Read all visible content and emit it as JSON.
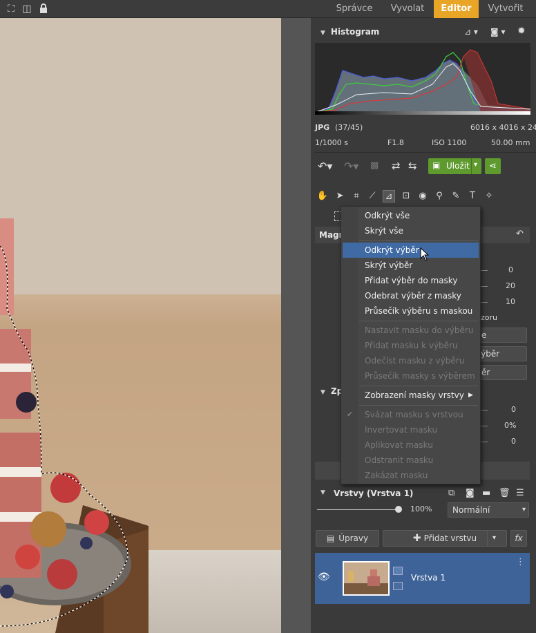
{
  "topbar": {
    "icons": [
      "fullscreen-icon",
      "compare-icon",
      "lock-icon"
    ],
    "modules": [
      {
        "label": "Správce",
        "active": false
      },
      {
        "label": "Vyvolat",
        "active": false
      },
      {
        "label": "Editor",
        "active": true
      },
      {
        "label": "Vytvořit",
        "active": false
      }
    ]
  },
  "histogram": {
    "title": "Histogram",
    "format": "JPG",
    "index": "(37/45)",
    "dimensions": "6016 x 4016 x 24",
    "shutter": "1/1000 s",
    "aperture": "F1.8",
    "iso": "ISO 1100",
    "focal": "50.00 mm"
  },
  "actions": {
    "save_label": "Uložit"
  },
  "sections": {
    "magic_title": "Magr",
    "zp_title": "Zp",
    "layers_title": "Vrstvy (Vrstva 1)"
  },
  "sliders": {
    "v1": "0",
    "v2": "20",
    "v3": "10",
    "row_text": "zoru",
    "btn1": "e",
    "btn2": "výběr",
    "btn3": "ěr",
    "z1": "0",
    "z2": "0%",
    "z3": "0"
  },
  "layers": {
    "opacity": "100%",
    "blend_mode": "Normální",
    "adjust_label": "Úpravy",
    "add_layer_label": "Přidat vrstvu",
    "fx_label": "fx",
    "layer_name": "Vrstva 1"
  },
  "menu": {
    "items": [
      {
        "label": "Odkrýt vše",
        "enabled": true
      },
      {
        "label": "Skrýt vše",
        "enabled": true
      },
      {
        "label": "Odkrýt výběr",
        "enabled": true,
        "highlighted": true
      },
      {
        "label": "Skrýt výběr",
        "enabled": true
      },
      {
        "label": "Přidat výběr do masky",
        "enabled": true
      },
      {
        "label": "Odebrat výběr z masky",
        "enabled": true
      },
      {
        "label": "Průsečík výběru s maskou",
        "enabled": true
      },
      {
        "label": "Nastavit masku do výběru",
        "enabled": false
      },
      {
        "label": "Přidat masku k výběru",
        "enabled": false
      },
      {
        "label": "Odečíst masku z výběru",
        "enabled": false
      },
      {
        "label": "Průsečík masky s výběrem",
        "enabled": false
      },
      {
        "label": "Zobrazení masky vrstvy",
        "enabled": true,
        "submenu": true
      },
      {
        "label": "Svázat masku s vrstvou",
        "enabled": false,
        "checked": true
      },
      {
        "label": "Invertovat masku",
        "enabled": false
      },
      {
        "label": "Aplikovat masku",
        "enabled": false
      },
      {
        "label": "Odstranit masku",
        "enabled": false
      },
      {
        "label": "Zakázat masku",
        "enabled": false
      }
    ]
  },
  "colors": {
    "accent": "#e8a526",
    "selection_blue": "#3e6398",
    "save_green": "#5f9a2e"
  }
}
